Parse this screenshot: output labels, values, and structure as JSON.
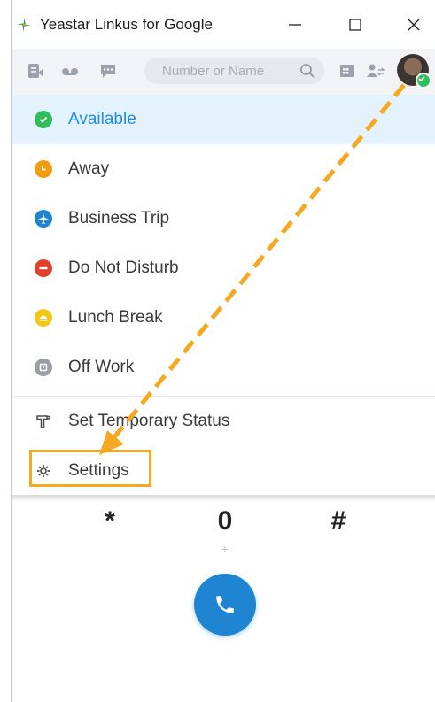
{
  "window": {
    "title": "Yeastar Linkus for Google",
    "minimize_glyph": "—",
    "maximize_glyph": "☐",
    "close_glyph": "✕"
  },
  "toolbar": {
    "icons": [
      "call-log-icon",
      "voicemail-icon",
      "chat-icon",
      "dialpad-icon",
      "transfer-icon"
    ],
    "search": {
      "placeholder": "Number or Name",
      "value": ""
    }
  },
  "status_menu": {
    "items": [
      {
        "label": "Available",
        "icon": "check-icon",
        "color": "#2fbf5a",
        "active": true
      },
      {
        "label": "Away",
        "icon": "clock-icon",
        "color": "#f39c12",
        "active": false
      },
      {
        "label": "Business Trip",
        "icon": "airplane-icon",
        "color": "#1f84d1",
        "active": false
      },
      {
        "label": "Do Not Disturb",
        "icon": "minus-icon",
        "color": "#e0402c",
        "active": false
      },
      {
        "label": "Lunch Break",
        "icon": "lunch-icon",
        "color": "#f5c518",
        "active": false
      },
      {
        "label": "Off Work",
        "icon": "off-work-icon",
        "color": "#9a9ea6",
        "active": false
      }
    ],
    "set_temporary_status": "Set Temporary Status",
    "settings": "Settings"
  },
  "dialpad": {
    "star": "*",
    "zero": "0",
    "zero_sub": "+",
    "hash": "#"
  },
  "colors": {
    "accent": "#1f8fe6",
    "highlight": "#f5a822",
    "active_bg": "#e3f2fc"
  }
}
